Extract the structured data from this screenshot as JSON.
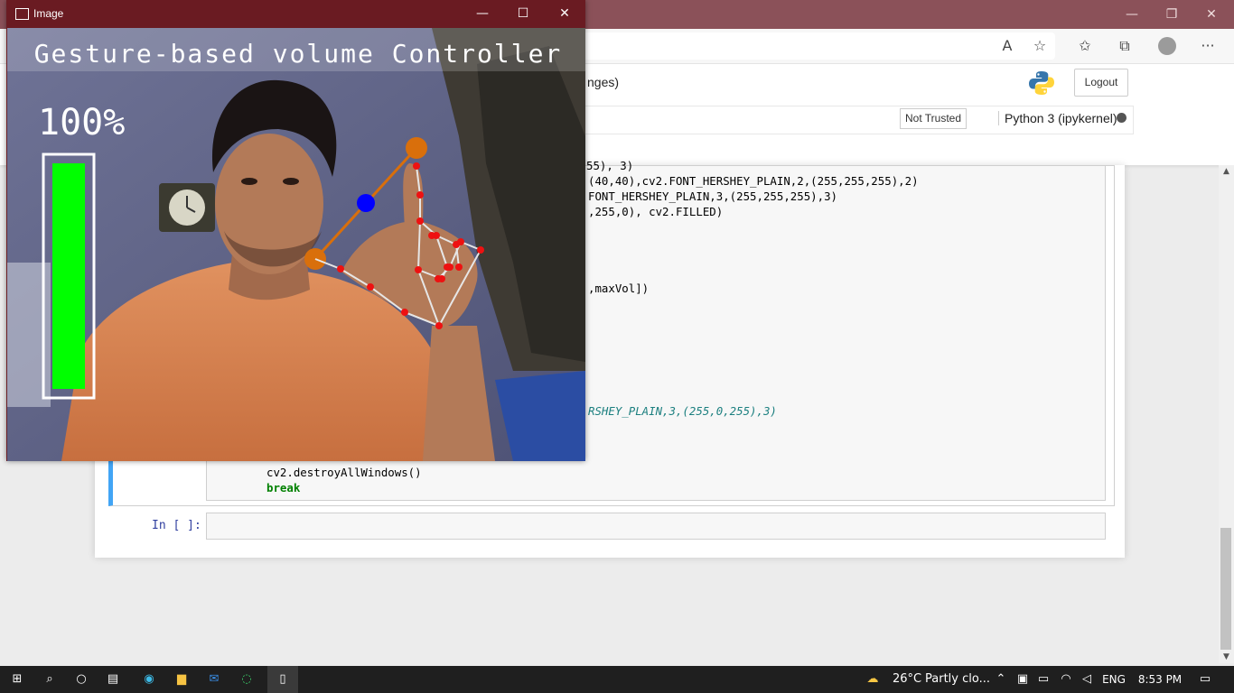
{
  "browser": {
    "controls": {
      "minimize": "—",
      "restore": "❐",
      "close": "✕"
    },
    "toolbar_icons": [
      "read-aloud-icon",
      "add-favorite-icon",
      "favorites-icon",
      "collections-icon",
      "profile-icon",
      "more-icon"
    ],
    "more_label": "···"
  },
  "jupyter": {
    "notebook_name_fragment": "nges)",
    "logout_label": "Logout",
    "trust_status": "Not Trusted",
    "kernel_name": "Python 3 (ipykernel)"
  },
  "code_lines": {
    "l1": "55), 3)",
    "l2a": "(40,40),cv2.FONT_HERSHEY_PLAIN,2,(255,255,255),2)",
    "l3": "FONT_HERSHEY_PLAIN,3,(255,255,255),3)",
    "l4": ",255,0), cv2.FILLED)",
    "l5": ",maxVol])",
    "l6": "RSHEY_PLAIN,3,(255,0,255),3)",
    "l7": "cv2.destroyAllWindows()",
    "l8": "break"
  },
  "next_cell_prompt": "In [ ]:",
  "image_window": {
    "title": "Image",
    "overlay_title": "Gesture-based volume Controller",
    "volume_percent_label": "100%",
    "volume_level": 1.0,
    "bar_color": "#00ff00",
    "controls": {
      "minimize": "—",
      "maximize": "☐",
      "close": "✕"
    }
  },
  "taskbar": {
    "weather_temp": "26°C",
    "weather_desc": "Partly clo...",
    "language": "ENG",
    "time": "8:53 PM",
    "pinned_apps": [
      "start-icon",
      "search-icon",
      "cortana-icon",
      "task-view-icon",
      "edge-icon",
      "file-explorer-icon",
      "mail-icon",
      "jupyter-loader-icon",
      "notepad-icon"
    ]
  }
}
